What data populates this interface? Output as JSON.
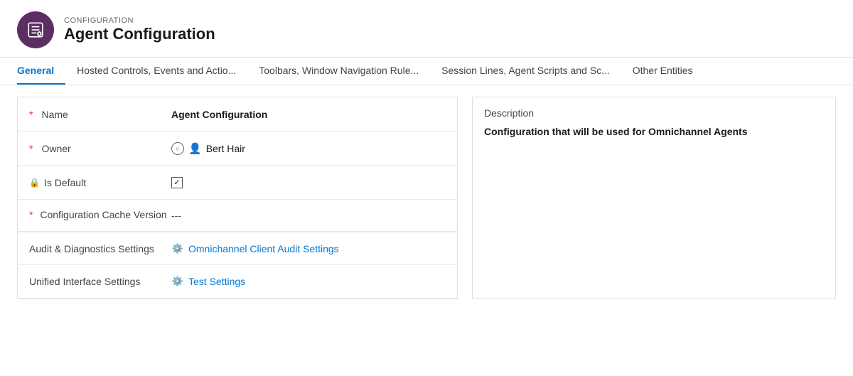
{
  "header": {
    "subtitle": "CONFIGURATION",
    "title": "Agent Configuration",
    "icon_label": "agent-config-icon"
  },
  "tabs": [
    {
      "id": "general",
      "label": "General",
      "active": true
    },
    {
      "id": "hosted-controls",
      "label": "Hosted Controls, Events and Actio...",
      "active": false
    },
    {
      "id": "toolbars",
      "label": "Toolbars, Window Navigation Rule...",
      "active": false
    },
    {
      "id": "session-lines",
      "label": "Session Lines, Agent Scripts and Sc...",
      "active": false
    },
    {
      "id": "other-entities",
      "label": "Other Entities",
      "active": false
    }
  ],
  "form": {
    "rows": [
      {
        "id": "name",
        "label": "Name",
        "required": true,
        "type": "text",
        "value": "Agent Configuration"
      },
      {
        "id": "owner",
        "label": "Owner",
        "required": true,
        "type": "owner",
        "value": "Bert Hair"
      },
      {
        "id": "is-default",
        "label": "Is Default",
        "type": "checkbox",
        "checked": true
      },
      {
        "id": "config-cache-version",
        "label": "Configuration Cache Version",
        "required": true,
        "type": "dash",
        "value": "---"
      },
      {
        "id": "audit-diagnostics",
        "label": "Audit & Diagnostics Settings",
        "type": "link",
        "value": "Omnichannel Client Audit Settings"
      },
      {
        "id": "unified-interface",
        "label": "Unified Interface Settings",
        "type": "link",
        "value": "Test Settings"
      }
    ]
  },
  "description": {
    "title": "Description",
    "text": "Configuration that will be used for Omnichannel Agents"
  }
}
